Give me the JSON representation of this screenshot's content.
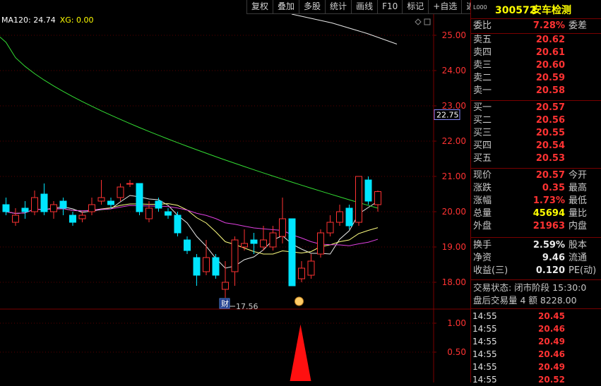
{
  "toolbar": [
    "复权",
    "叠加",
    "多股",
    "统计",
    "画线",
    "F10",
    "标记",
    "+自选",
    "返回"
  ],
  "indicator": {
    "text": "MA120: 24.74",
    "xg": "XG: 0.00"
  },
  "price_axis": [
    "25.00",
    "24.00",
    "23.00",
    "22.00",
    "21.00",
    "20.00",
    "19.00",
    "18.00"
  ],
  "current_price_tag": "22.75",
  "low_annotation": "17.56",
  "badge_label": "财",
  "volume_axis": [
    "1.00",
    "0.50"
  ],
  "stock": {
    "code": "300572",
    "name": "安车检测",
    "small_tag": "L000"
  },
  "ratio": {
    "label": "委比",
    "value": "7.28%",
    "right_label": "委差"
  },
  "asks": [
    {
      "label": "卖五",
      "price": "20.62"
    },
    {
      "label": "卖四",
      "price": "20.61"
    },
    {
      "label": "卖三",
      "price": "20.60"
    },
    {
      "label": "卖二",
      "price": "20.59"
    },
    {
      "label": "卖一",
      "price": "20.58"
    }
  ],
  "bids": [
    {
      "label": "买一",
      "price": "20.57"
    },
    {
      "label": "买二",
      "price": "20.56"
    },
    {
      "label": "买三",
      "price": "20.55"
    },
    {
      "label": "买四",
      "price": "20.54"
    },
    {
      "label": "买五",
      "price": "20.53"
    }
  ],
  "quote": [
    {
      "label": "现价",
      "value": "20.57",
      "right": "今开"
    },
    {
      "label": "涨跌",
      "value": "0.35",
      "right": "最高"
    },
    {
      "label": "涨幅",
      "value": "1.73%",
      "right": "最低"
    },
    {
      "label": "总量",
      "value": "45694",
      "right": "量比"
    },
    {
      "label": "外盘",
      "value": "21963",
      "right": "内盘"
    }
  ],
  "stats": [
    {
      "label": "换手",
      "value": "2.59%",
      "right": "股本"
    },
    {
      "label": "净资",
      "value": "9.46",
      "right": "流通"
    },
    {
      "label": "收益(三)",
      "value": "0.120",
      "right": "PE(动)"
    }
  ],
  "trade_status": "交易状态: 闭市阶段 15:30:0",
  "after_hours": "盘后交易量 4 额 8228.00",
  "ticks": [
    {
      "time": "14:55",
      "price": "20.45"
    },
    {
      "time": "14:55",
      "price": "20.46"
    },
    {
      "time": "14:55",
      "price": "20.49"
    },
    {
      "time": "14:55",
      "price": "20.46"
    },
    {
      "time": "14:55",
      "price": "20.49"
    },
    {
      "time": "14:55",
      "price": "20.52"
    }
  ],
  "colors": {
    "up": "#ff3232",
    "down": "#00e5ff",
    "ma_green": "#33dd33",
    "ma_magenta": "#e040e0",
    "ma_yellow": "#ffff80",
    "ma_white": "#e8e8e8",
    "frame": "#7a0000"
  },
  "candles": [
    {
      "o": 20.2,
      "c": 20.0,
      "h": 20.4,
      "l": 19.9
    },
    {
      "o": 19.7,
      "c": 19.9,
      "h": 20.1,
      "l": 19.6
    },
    {
      "o": 20.1,
      "c": 20.0,
      "h": 20.3,
      "l": 19.8
    },
    {
      "o": 20.0,
      "c": 20.4,
      "h": 20.6,
      "l": 19.9
    },
    {
      "o": 20.5,
      "c": 20.0,
      "h": 20.8,
      "l": 19.9
    },
    {
      "o": 20.0,
      "c": 20.2,
      "h": 20.3,
      "l": 19.8
    },
    {
      "o": 20.3,
      "c": 20.1,
      "h": 20.4,
      "l": 19.9
    },
    {
      "o": 19.9,
      "c": 19.7,
      "h": 20.0,
      "l": 19.6
    },
    {
      "o": 19.8,
      "c": 19.9,
      "h": 20.0,
      "l": 19.7
    },
    {
      "o": 20.0,
      "c": 20.2,
      "h": 20.4,
      "l": 19.9
    },
    {
      "o": 20.3,
      "c": 20.4,
      "h": 20.9,
      "l": 20.2
    },
    {
      "o": 20.3,
      "c": 20.2,
      "h": 20.4,
      "l": 20.1
    },
    {
      "o": 20.4,
      "c": 20.7,
      "h": 20.8,
      "l": 20.3
    },
    {
      "o": 20.8,
      "c": 20.8,
      "h": 20.9,
      "l": 20.7
    },
    {
      "o": 20.8,
      "c": 20.0,
      "h": 20.8,
      "l": 19.9
    },
    {
      "o": 19.8,
      "c": 20.1,
      "h": 20.3,
      "l": 19.7
    },
    {
      "o": 20.3,
      "c": 20.1,
      "h": 20.4,
      "l": 20.0
    },
    {
      "o": 20.0,
      "c": 19.9,
      "h": 20.1,
      "l": 19.8
    },
    {
      "o": 19.9,
      "c": 19.4,
      "h": 20.0,
      "l": 19.3
    },
    {
      "o": 19.2,
      "c": 18.9,
      "h": 19.3,
      "l": 18.8
    },
    {
      "o": 18.7,
      "c": 18.2,
      "h": 18.8,
      "l": 17.9
    },
    {
      "o": 18.3,
      "c": 18.7,
      "h": 19.2,
      "l": 18.2
    },
    {
      "o": 18.7,
      "c": 18.2,
      "h": 18.8,
      "l": 18.1
    },
    {
      "o": 17.8,
      "c": 18.0,
      "h": 18.6,
      "l": 17.56
    },
    {
      "o": 18.3,
      "c": 19.2,
      "h": 19.3,
      "l": 17.9
    },
    {
      "o": 19.0,
      "c": 19.1,
      "h": 19.5,
      "l": 18.9
    },
    {
      "o": 19.2,
      "c": 19.1,
      "h": 19.4,
      "l": 18.8
    },
    {
      "o": 19.0,
      "c": 19.2,
      "h": 19.6,
      "l": 18.9
    },
    {
      "o": 19.0,
      "c": 19.4,
      "h": 19.6,
      "l": 18.9
    },
    {
      "o": 19.3,
      "c": 19.8,
      "h": 20.4,
      "l": 19.1
    },
    {
      "o": 19.8,
      "c": 17.9,
      "h": 19.8,
      "l": 17.9
    },
    {
      "o": 18.1,
      "c": 18.4,
      "h": 18.6,
      "l": 18.0
    },
    {
      "o": 18.2,
      "c": 18.6,
      "h": 18.8,
      "l": 18.1
    },
    {
      "o": 18.8,
      "c": 19.4,
      "h": 19.5,
      "l": 18.7
    },
    {
      "o": 19.4,
      "c": 19.7,
      "h": 19.9,
      "l": 19.3
    },
    {
      "o": 19.7,
      "c": 20.0,
      "h": 20.2,
      "l": 19.6
    },
    {
      "o": 20.1,
      "c": 19.6,
      "h": 20.2,
      "l": 19.5
    },
    {
      "o": 19.7,
      "c": 21.0,
      "h": 21.0,
      "l": 19.6
    },
    {
      "o": 20.9,
      "c": 20.3,
      "h": 21.0,
      "l": 20.2
    },
    {
      "o": 20.2,
      "c": 20.57,
      "h": 20.6,
      "l": 20.0
    }
  ]
}
